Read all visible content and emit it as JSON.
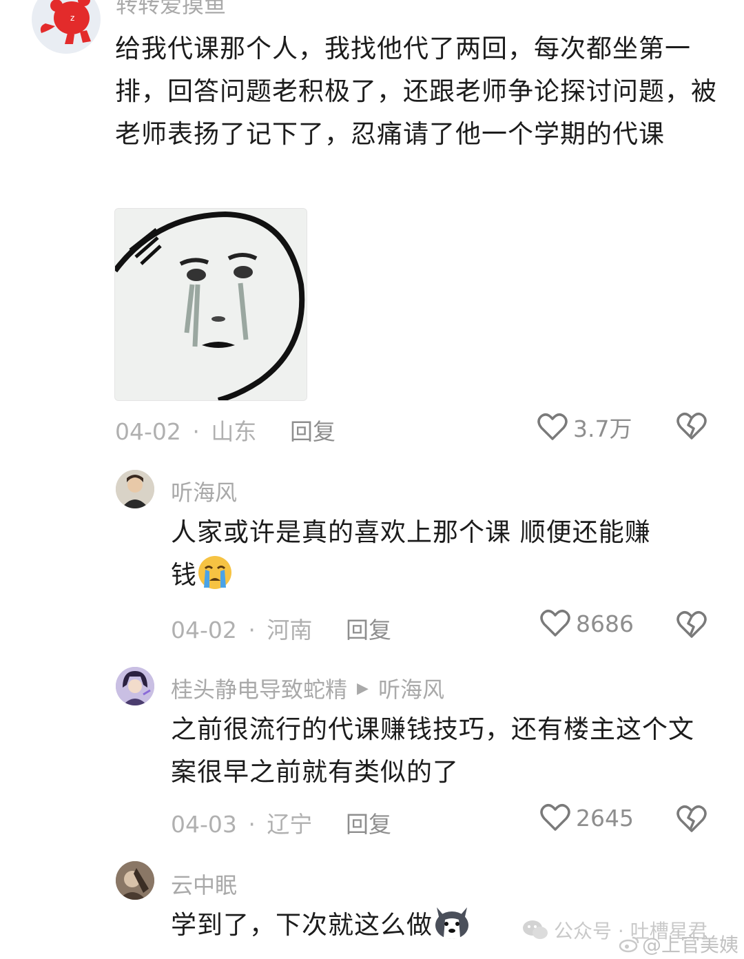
{
  "comments": [
    {
      "username": "转转爱摸鱼",
      "text": "给我代课那个人，我找他代了两回，每次都坐第一排，回答问题老积极了，还跟老师争论探讨问题，被老师表扬了记下了，忍痛请了他一个学期的代课",
      "date": "04-02",
      "location": "山东",
      "reply_label": "回复",
      "likes": "3.7万"
    },
    {
      "username": "听海风",
      "text_line1": "人家或许是真的喜欢上那个课 顺便还能赚",
      "text_line2": "钱",
      "emoji": "crying-face-icon",
      "date": "04-02",
      "location": "河南",
      "reply_label": "回复",
      "likes": "8686"
    },
    {
      "username": "桂头静电导致蛇精",
      "reply_to": "听海风",
      "text": "之前很流行的代课赚钱技巧，还有楼主这个文案很早之前就有类似的了",
      "date": "04-03",
      "location": "辽宁",
      "reply_label": "回复",
      "likes": "2645"
    },
    {
      "username": "云中眠",
      "text": "学到了，下次就这么做",
      "emoji": "husky-face-icon"
    }
  ],
  "separator": "·",
  "watermark": {
    "wechat": "公众号 · 吐槽星君",
    "weibo": "@上官美姨"
  },
  "colors": {
    "text": "#1c1c1c",
    "muted": "#a9a9a9",
    "background": "#ffffff"
  }
}
